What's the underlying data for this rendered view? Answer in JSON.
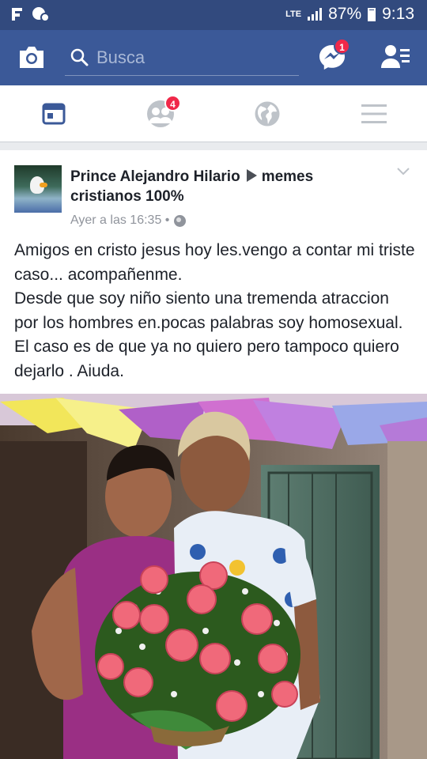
{
  "status_bar": {
    "network": "LTE",
    "battery": "87%",
    "time": "9:13",
    "battery_level": 0.87
  },
  "top_bar": {
    "search_placeholder": "Busca",
    "messages_badge": "1",
    "background_color": "#3b5998"
  },
  "tabs": [
    {
      "name": "news-feed",
      "icon": "news-feed-icon",
      "active": true
    },
    {
      "name": "friend-requests",
      "icon": "friends-icon",
      "badge": "4"
    },
    {
      "name": "notifications",
      "icon": "globe-icon"
    },
    {
      "name": "menu",
      "icon": "hamburger-icon"
    }
  ],
  "post": {
    "author": "Prince Alejandro Hilario",
    "group": "memes cristianos 100%",
    "timestamp": "Ayer a las 16:35 •",
    "privacy_icon": "globe-icon",
    "text": "Amigos en cristo jesus hoy les.vengo a contar mi triste caso... acompañenme.\nDesde que soy niño siento una tremenda atraccion por los hombres en.pocas palabras soy homosexual. El caso es de que ya no quiero pero tampoco quiero dejarlo . Aiuda."
  }
}
